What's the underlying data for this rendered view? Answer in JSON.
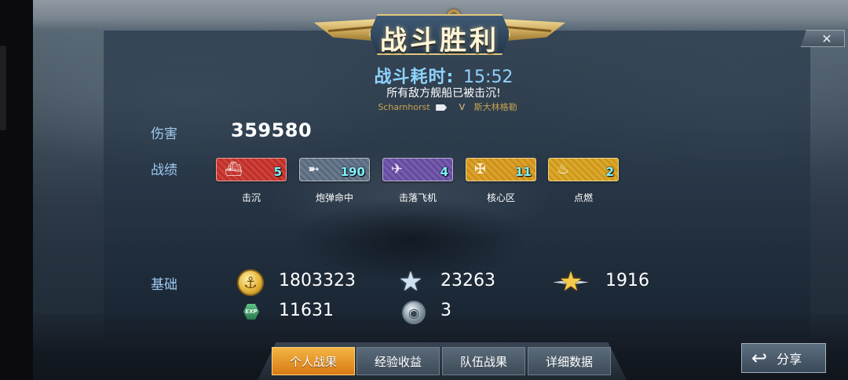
{
  "header": {
    "title": "战斗胜利",
    "close_icon": "close-icon"
  },
  "battle": {
    "time_label": "战斗耗时:",
    "time_value": "15:52",
    "result_message": "所有敌方舰船已被击沉!",
    "own_ship": "Scharnhorst",
    "vs": "V",
    "enemy_ship": "斯大林格勒"
  },
  "damage": {
    "label": "伤害",
    "value": "359580"
  },
  "achievements": {
    "label": "战绩",
    "items": [
      {
        "label": "击沉",
        "count": "5",
        "icon": "sink-medal-icon",
        "color": "#c9322a"
      },
      {
        "label": "炮弹命中",
        "count": "190",
        "icon": "shell-hit-medal-icon",
        "color": "#5e6f85"
      },
      {
        "label": "击落飞机",
        "count": "4",
        "icon": "aircraft-shotdown-medal-icon",
        "color": "#6a4fa6"
      },
      {
        "label": "核心区",
        "count": "11",
        "icon": "citadel-medal-icon",
        "color": "#d99a1c"
      },
      {
        "label": "点燃",
        "count": "2",
        "icon": "fire-medal-icon",
        "color": "#d9a21c"
      }
    ]
  },
  "basic": {
    "label": "基础",
    "credits": "1803323",
    "silver_star": "23263",
    "gold_star": "1916",
    "exp": "11631",
    "globe": "3",
    "exp_text": "EXP"
  },
  "tabs": [
    {
      "label": "个人战果",
      "active": true
    },
    {
      "label": "经验收益",
      "active": false
    },
    {
      "label": "队伍战果",
      "active": false
    },
    {
      "label": "详细数据",
      "active": false
    }
  ],
  "share": {
    "label": "分享"
  }
}
